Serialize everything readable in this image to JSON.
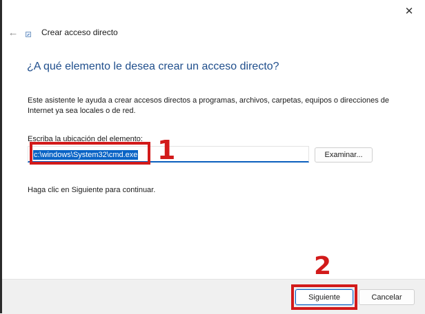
{
  "window": {
    "close_glyph": "✕",
    "back_glyph": "←",
    "title": "Crear acceso directo"
  },
  "wizard": {
    "heading": "¿A qué elemento le desea crear un acceso directo?",
    "description": "Este asistente le ayuda a crear accesos directos a programas, archivos, carpetas, equipos o direcciones de Internet ya sea locales o de red.",
    "location_label": "Escriba la ubicación del elemento:",
    "location_value": "c:\\windows\\System32\\cmd.exe",
    "browse_label": "Examinar...",
    "continue_hint": "Haga clic en Siguiente para continuar."
  },
  "annotations": {
    "step1": "1",
    "step2": "2",
    "color": "#d21a1a"
  },
  "footer": {
    "next_label": "Siguiente",
    "cancel_label": "Cancelar"
  },
  "icons": {
    "close": "close-icon",
    "back": "back-arrow-icon",
    "wizard": "shortcut-wizard-icon"
  },
  "colors": {
    "heading": "#1f4e8c",
    "accent": "#0a5ebd",
    "selection": "#0a64c6"
  }
}
